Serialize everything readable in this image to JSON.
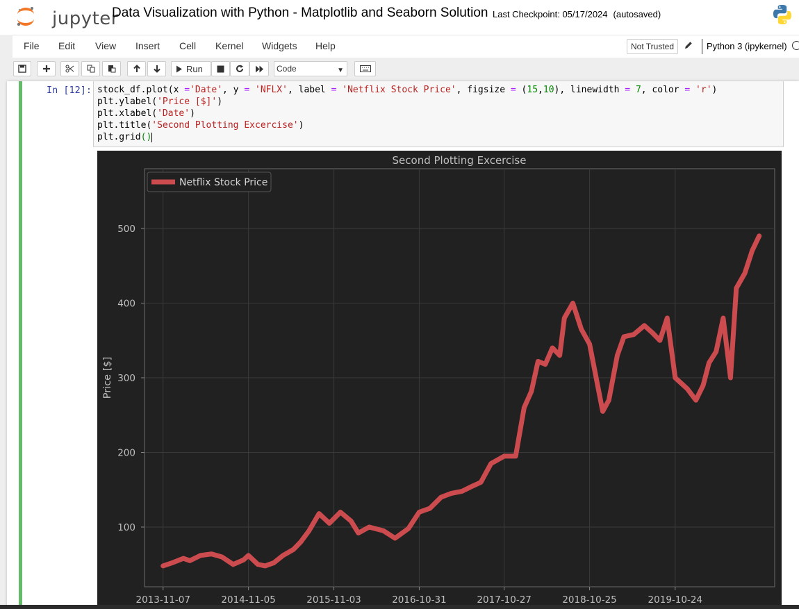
{
  "header": {
    "logo_text": "jupyter",
    "notebook_title": "Data Visualization with Python - Matplotlib and Seaborn Solution",
    "checkpoint": "Last Checkpoint: 05/17/2024",
    "autosave_status": "(autosaved)"
  },
  "menu": [
    "File",
    "Edit",
    "View",
    "Insert",
    "Cell",
    "Kernel",
    "Widgets",
    "Help"
  ],
  "trust_status": "Not Trusted",
  "kernel_name": "Python 3 (ipykernel)",
  "toolbar": {
    "run_label": "Run",
    "cell_type": "Code",
    "icons": [
      "save-icon",
      "plus-icon",
      "scissors-icon",
      "copy-icon",
      "paste-icon",
      "arrow-up-icon",
      "arrow-down-icon",
      "play-icon",
      "stop-icon",
      "restart-icon",
      "fast-forward-icon",
      "keyboard-icon"
    ]
  },
  "cell": {
    "prompt": "In [12]:",
    "code": [
      "stock_df.plot(x ='Date', y = 'NFLX', label = 'Netflix Stock Price', figsize = (15,10), linewidth = 7, color = 'r')",
      "plt.ylabel('Price [$]')",
      "plt.xlabel('Date')",
      "plt.title('Second Plotting Excercise')",
      "plt.grid()"
    ]
  },
  "chart_data": {
    "type": "line",
    "title": "Second Plotting Excercise",
    "xlabel": "Date",
    "ylabel": "Price [$]",
    "legend": "Netflix Stock Price",
    "legend_position": "top-left",
    "series_color": "#cc4b4e",
    "background": "#212121",
    "grid": true,
    "x_ticks": [
      "2013-11-07",
      "2014-11-05",
      "2015-11-03",
      "2016-10-31",
      "2017-10-27",
      "2018-10-25",
      "2019-10-24"
    ],
    "y_ticks": [
      100,
      200,
      300,
      400,
      500
    ],
    "xlim": [
      "2013-08-20",
      "2020-12-20"
    ],
    "ylim": [
      20,
      580
    ],
    "series": [
      {
        "name": "Netflix Stock Price",
        "x": [
          "2013-11-07",
          "2013-12-15",
          "2014-02-01",
          "2014-03-01",
          "2014-04-15",
          "2014-06-01",
          "2014-07-15",
          "2014-09-01",
          "2014-10-15",
          "2014-11-05",
          "2014-12-15",
          "2015-01-15",
          "2015-02-20",
          "2015-04-01",
          "2015-05-15",
          "2015-06-15",
          "2015-07-20",
          "2015-09-01",
          "2015-10-15",
          "2015-12-01",
          "2016-01-15",
          "2016-02-15",
          "2016-04-01",
          "2016-06-01",
          "2016-07-20",
          "2016-09-15",
          "2016-10-31",
          "2016-12-15",
          "2017-02-01",
          "2017-03-15",
          "2017-05-01",
          "2017-06-15",
          "2017-07-20",
          "2017-09-01",
          "2017-10-27",
          "2017-12-15",
          "2018-01-20",
          "2018-02-20",
          "2018-03-20",
          "2018-04-20",
          "2018-05-20",
          "2018-06-20",
          "2018-07-10",
          "2018-08-15",
          "2018-09-20",
          "2018-10-25",
          "2018-12-20",
          "2019-01-15",
          "2019-02-20",
          "2019-03-20",
          "2019-05-01",
          "2019-06-15",
          "2019-07-20",
          "2019-08-20",
          "2019-09-20",
          "2019-10-24",
          "2019-12-15",
          "2020-01-20",
          "2020-02-20",
          "2020-03-16",
          "2020-04-15",
          "2020-05-15",
          "2020-06-15",
          "2020-07-10",
          "2020-08-15",
          "2020-09-15",
          "2020-10-15"
        ],
        "values": [
          48,
          52,
          58,
          55,
          62,
          64,
          60,
          50,
          56,
          62,
          50,
          48,
          52,
          62,
          70,
          80,
          95,
          118,
          105,
          120,
          108,
          92,
          100,
          95,
          85,
          98,
          120,
          125,
          140,
          145,
          148,
          155,
          160,
          185,
          195,
          195,
          260,
          282,
          322,
          318,
          340,
          330,
          380,
          400,
          365,
          345,
          255,
          270,
          330,
          355,
          358,
          370,
          360,
          350,
          380,
          300,
          285,
          270,
          290,
          320,
          335,
          380,
          300,
          420,
          440,
          470,
          490
        ]
      }
    ]
  }
}
